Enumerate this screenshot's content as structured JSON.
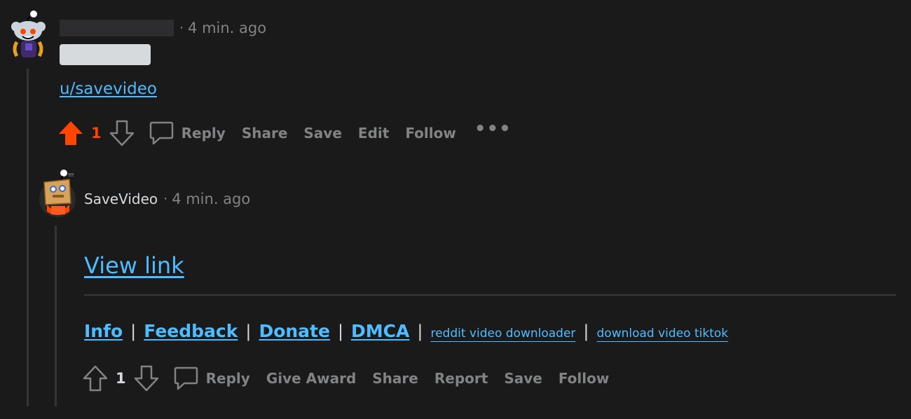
{
  "comment1": {
    "time": "4 min. ago",
    "separator": "·",
    "body_link": "u/savevideo",
    "votes": "1",
    "actions": {
      "reply": "Reply",
      "share": "Share",
      "save": "Save",
      "edit": "Edit",
      "follow": "Follow",
      "more": "•••"
    }
  },
  "comment2": {
    "author": "SaveVideo",
    "separator": "·",
    "time": "4 min. ago",
    "view_link": "View link",
    "footer_links": {
      "info": "Info",
      "feedback": "Feedback",
      "donate": "Donate",
      "dmca": "DMCA",
      "reddit_dl": "reddit video downloader",
      "tiktok_dl": "download video tiktok",
      "pipe": "|"
    },
    "votes": "1",
    "actions": {
      "reply": "Reply",
      "give_award": "Give Award",
      "share": "Share",
      "report": "Report",
      "save": "Save",
      "follow": "Follow"
    }
  },
  "colors": {
    "background": "#1a1a1b",
    "upvote_active": "#ff4500",
    "link": "#4fbcff",
    "muted": "#818384"
  }
}
